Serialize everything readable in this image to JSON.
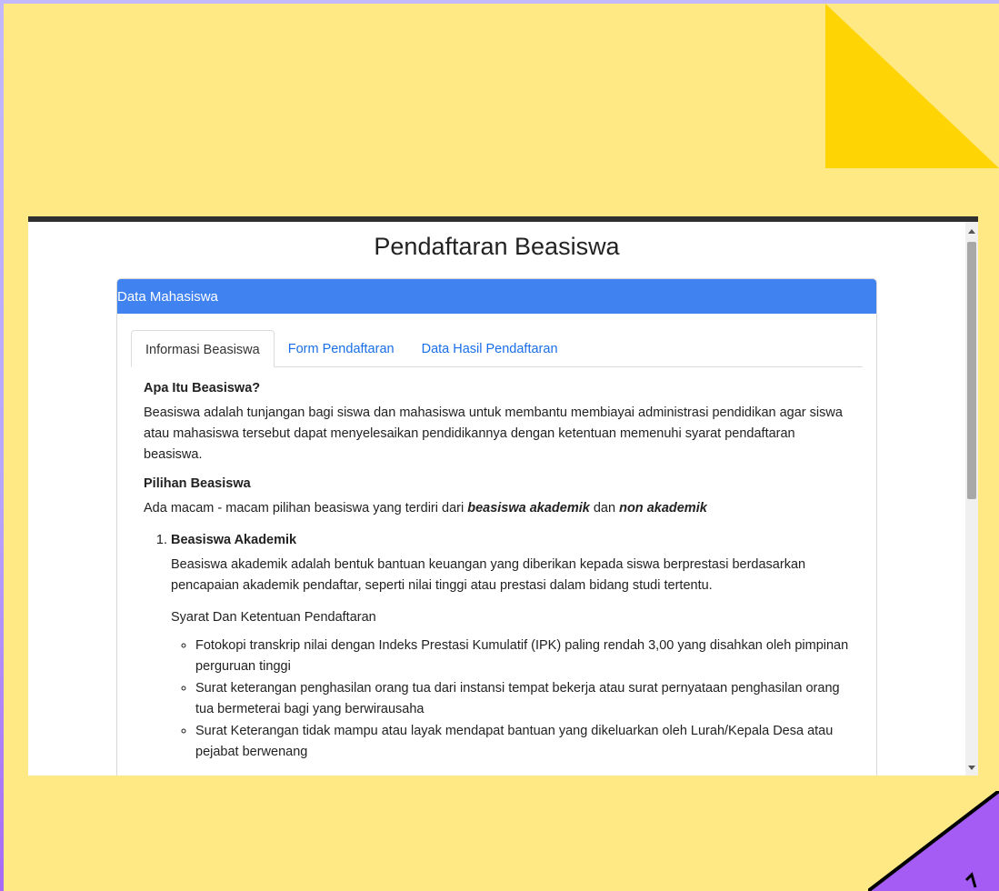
{
  "page_title": "Pendaftaran Beasiswa",
  "card_header": "Data Mahasiswa",
  "tabs": [
    {
      "label": "Informasi Beasiswa",
      "active": true
    },
    {
      "label": "Form Pendaftaran",
      "active": false
    },
    {
      "label": "Data Hasil Pendaftaran",
      "active": false
    }
  ],
  "section1": {
    "heading": "Apa Itu Beasiswa?",
    "text": "Beasiswa adalah tunjangan bagi siswa dan mahasiswa untuk membantu membiayai administrasi pendidikan agar siswa atau mahasiswa tersebut dapat menyelesaikan pendidikannya dengan ketentuan memenuhi syarat pendaftaran beasiswa."
  },
  "section2": {
    "heading": "Pilihan Beasiswa",
    "text_before": "Ada macam - macam pilihan beasiswa yang terdiri dari ",
    "emph1": "beasiswa akademik",
    "text_mid": " dan ",
    "emph2": "non akademik"
  },
  "list": {
    "item1_title": "Beasiswa Akademik",
    "item1_text": "Beasiswa akademik adalah bentuk bantuan keuangan yang diberikan kepada siswa berprestasi berdasarkan pencapaian akademik pendaftar, seperti nilai tinggi atau prestasi dalam bidang studi tertentu.",
    "syarat_heading": "Syarat Dan Ketentuan Pendaftaran",
    "requirements": [
      "Fotokopi transkrip nilai dengan Indeks Prestasi Kumulatif (IPK) paling rendah 3,00 yang disahkan oleh pimpinan perguruan tinggi",
      "Surat keterangan penghasilan orang tua dari instansi tempat bekerja atau surat pernyataan penghasilan orang tua bermeterai bagi yang berwirausaha",
      "Surat Keterangan tidak mampu atau layak mendapat bantuan yang dikeluarkan oleh Lurah/Kepala Desa atau pejabat berwenang"
    ]
  },
  "colors": {
    "slide_bg": "#ffe985",
    "accent_yellow": "#fed404",
    "accent_purple": "#a45cf4",
    "card_header": "#3f82f0",
    "tab_link": "#1a6fe8"
  }
}
